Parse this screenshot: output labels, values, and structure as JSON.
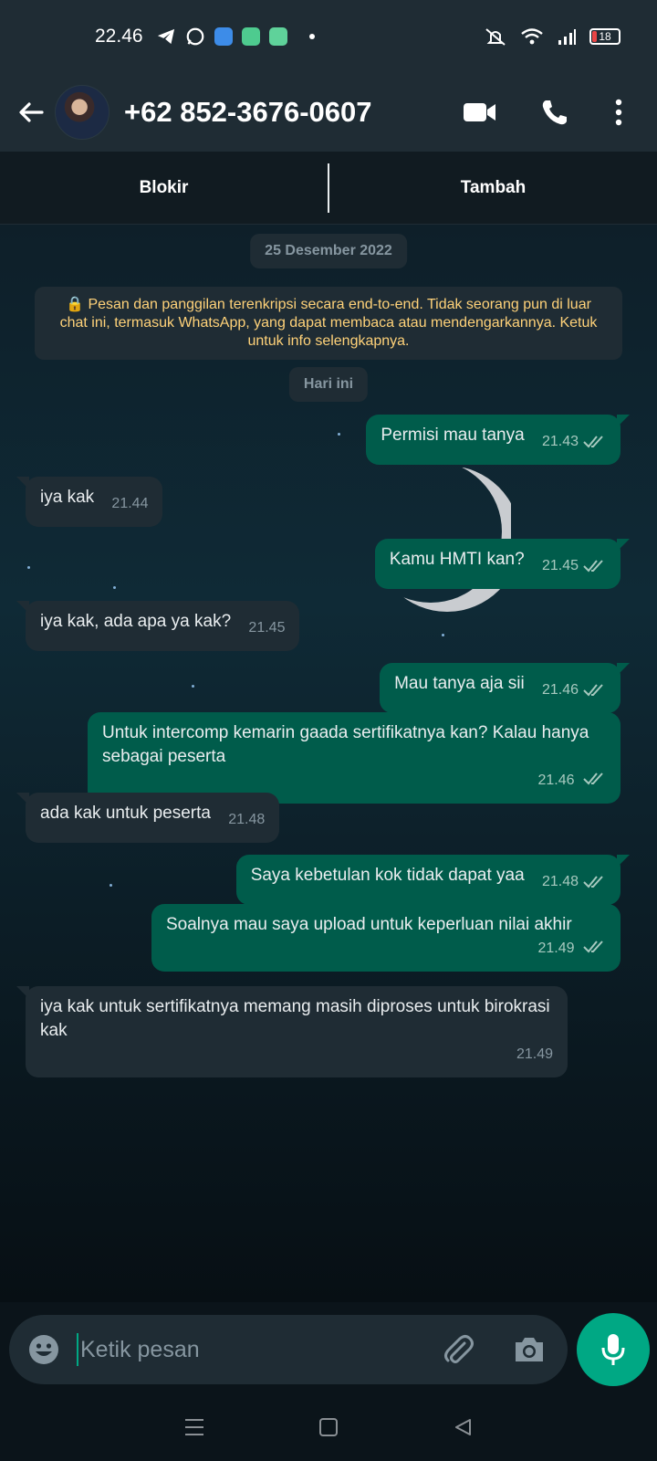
{
  "status_bar": {
    "time": "22.46",
    "battery": "18",
    "icons": [
      "telegram-icon",
      "whatsapp-icon",
      "app-icon",
      "app-icon",
      "app-icon",
      "dot-icon",
      "mute-icon",
      "wifi-icon",
      "signal-icon",
      "battery-icon"
    ]
  },
  "header": {
    "contact": "+62 852-3676-0607"
  },
  "actions": {
    "block": "Blokir",
    "add": "Tambah"
  },
  "chat": {
    "date_chip": "25 Desember 2022",
    "encryption_notice": "🔒 Pesan dan panggilan terenkripsi secara end-to-end. Tidak seorang pun di luar chat ini, termasuk WhatsApp, yang dapat membaca atau mendengarkannya. Ketuk untuk info selengkapnya.",
    "today_chip": "Hari ini",
    "messages": [
      {
        "dir": "out",
        "text": "Permisi mau tanya",
        "time": "21.43"
      },
      {
        "dir": "in",
        "text": "iya kak",
        "time": "21.44"
      },
      {
        "dir": "out",
        "text": "Kamu HMTI kan?",
        "time": "21.45"
      },
      {
        "dir": "in",
        "text": "iya kak, ada apa ya kak?",
        "time": "21.45"
      },
      {
        "dir": "out",
        "text": "Mau tanya aja sii",
        "time": "21.46"
      },
      {
        "dir": "out",
        "text": "Untuk intercomp kemarin gaada sertifikatnya kan? Kalau hanya sebagai peserta",
        "time": "21.46"
      },
      {
        "dir": "in",
        "text": "ada kak untuk peserta",
        "time": "21.48"
      },
      {
        "dir": "out",
        "text": "Saya kebetulan kok tidak dapat yaa",
        "time": "21.48"
      },
      {
        "dir": "out",
        "text": "Soalnya mau saya upload untuk keperluan nilai akhir",
        "time": "21.49"
      },
      {
        "dir": "in",
        "text": "iya kak untuk sertifikatnya memang masih diproses untuk birokrasi kak",
        "time": "21.49"
      }
    ]
  },
  "composer": {
    "placeholder": "Ketik pesan"
  },
  "colors": {
    "outgoing_bubble": "#005c4b",
    "incoming_bubble": "#1f2c34",
    "accent": "#00a884",
    "header_bg": "#1f2c34"
  }
}
